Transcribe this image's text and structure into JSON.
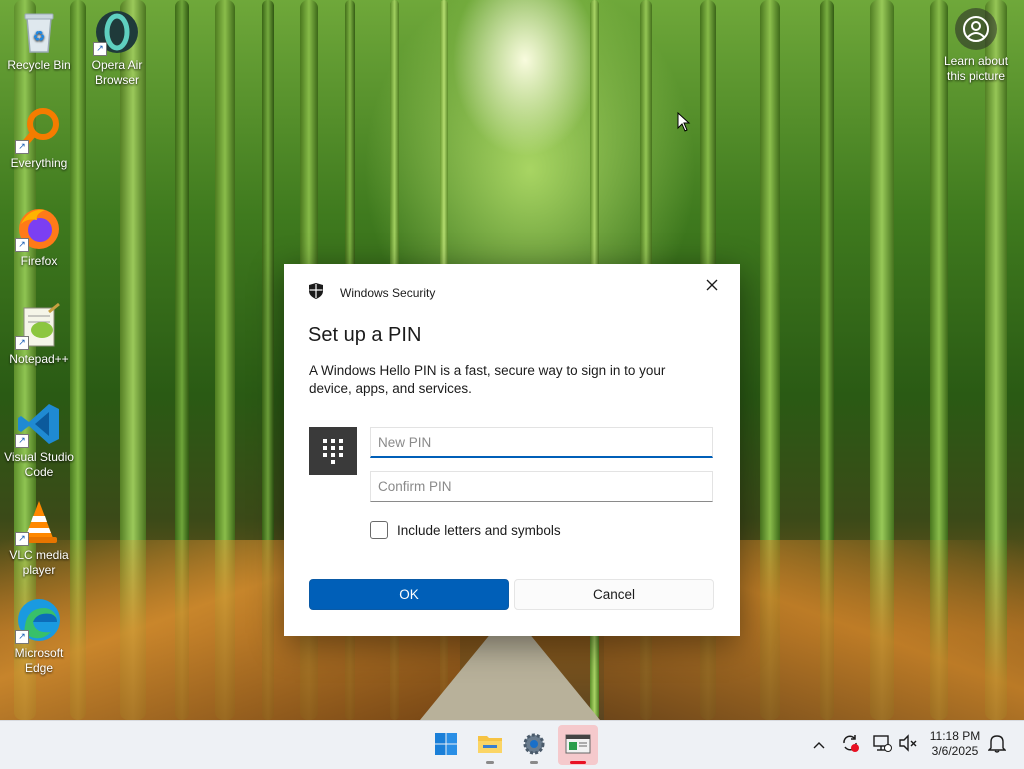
{
  "desktop": {
    "icons": [
      {
        "label": "Recycle Bin"
      },
      {
        "label": "Opera Air Browser"
      },
      {
        "label": "Everything"
      },
      {
        "label": "Firefox"
      },
      {
        "label": "Notepad++"
      },
      {
        "label": "Visual Studio Code"
      },
      {
        "label": "VLC media player"
      },
      {
        "label": "Microsoft Edge"
      }
    ],
    "learn_more": "Learn about this picture"
  },
  "dialog": {
    "app_name": "Windows Security",
    "title": "Set up a PIN",
    "description": "A Windows Hello PIN is a fast, secure way to sign in to your device, apps, and services.",
    "new_pin_placeholder": "New PIN",
    "confirm_pin_placeholder": "Confirm PIN",
    "include_label": "Include letters and symbols",
    "include_checked": false,
    "ok_label": "OK",
    "cancel_label": "Cancel",
    "accent_color": "#005fb8"
  },
  "taskbar": {
    "apps": [
      "start-icon",
      "file-explorer-icon",
      "settings-icon",
      "credential-app-icon"
    ],
    "clock": {
      "time": "11:18 PM",
      "date": "3/6/2025"
    }
  }
}
